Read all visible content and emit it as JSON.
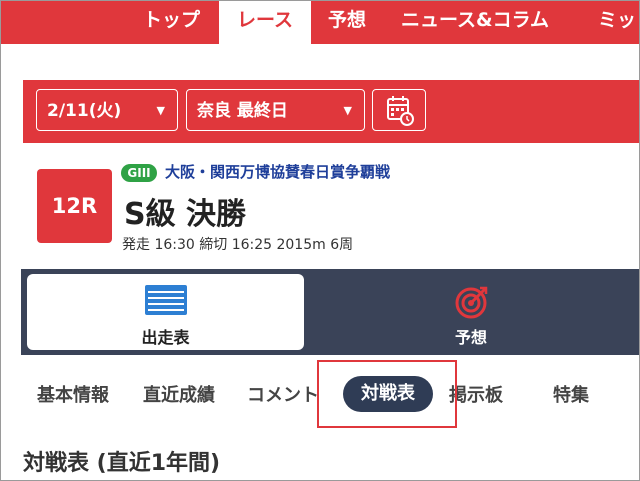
{
  "nav": {
    "tabs": [
      {
        "label": "トップ"
      },
      {
        "label": "レース"
      },
      {
        "label": "予想"
      },
      {
        "label": "ニュース&コラム"
      },
      {
        "label": "ミッ"
      }
    ],
    "active_index": 1
  },
  "filters": {
    "date": "2/11(火)",
    "venue": "奈良 最終日",
    "calendar_icon": "calendar-refresh-icon"
  },
  "race": {
    "number": "12R",
    "grade": "GIII",
    "name": "大阪・関西万博協賛春日賞争覇戦",
    "title": "S級 決勝",
    "info": "発走 16:30 締切 16:25 2015m 6周"
  },
  "main_tabs": [
    {
      "label": "出走表",
      "icon": "entry-table-icon",
      "active": true
    },
    {
      "label": "予想",
      "icon": "target-icon",
      "active": false
    }
  ],
  "sub_tabs": [
    {
      "label": "基本情報"
    },
    {
      "label": "直近成績"
    },
    {
      "label": "コメント"
    },
    {
      "label": "対戦表",
      "active": true
    },
    {
      "label": "掲示板"
    },
    {
      "label": "特集"
    }
  ],
  "section": {
    "title": "対戦表 (直近1年間)"
  },
  "colors": {
    "accent": "#e0373c",
    "dark": "#3a4358",
    "active_pill": "#2f3c55",
    "grade_green": "#2fa245",
    "link_blue": "#1f3f9a"
  }
}
